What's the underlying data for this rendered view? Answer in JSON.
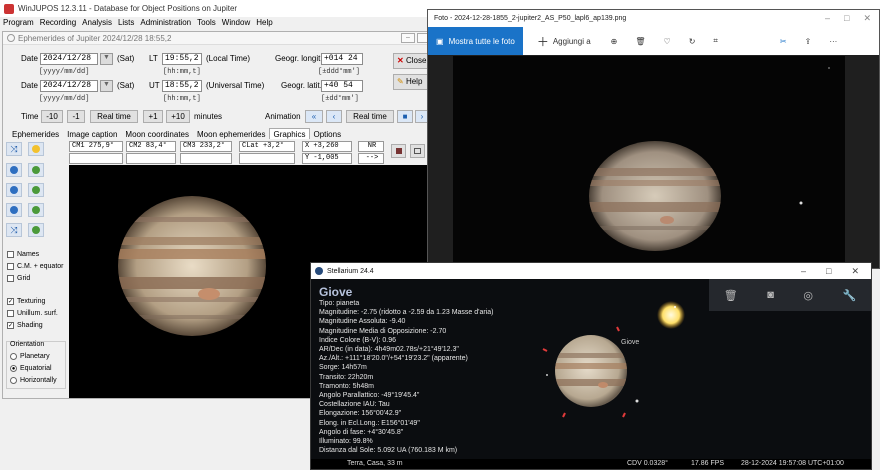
{
  "app": {
    "title": "WinJUPOS 12.3.11 - Database for Object Positions on Jupiter",
    "menu": [
      "Program",
      "Recording",
      "Analysis",
      "Lists",
      "Administration",
      "Tools",
      "Window",
      "Help"
    ]
  },
  "ephemerides": {
    "title": "Ephemerides of Jupiter  2024/12/28  18:55,2",
    "date_label": "Date",
    "date1": "2024/12/28",
    "sat1": "(Sat)",
    "lt_label": "LT",
    "lt_value": "19:55,2",
    "lt_desc": "(Local Time)",
    "date_fmt1": "[yyyy/mm/dd]",
    "time_fmt1": "[hh:mm,t]",
    "date2": "2024/12/28",
    "sat2": "(Sat)",
    "ut_label": "UT",
    "ut_value": "18:55,2",
    "ut_desc": "(Universal Time)",
    "date_fmt2": "[yyyy/mm/dd]",
    "time_fmt2": "[hh:mm,t]",
    "long_label": "Geogr. longit.",
    "long_value": "+014 24",
    "long_fmt": "[±ddd°mm']",
    "lat_label": "Geogr. latit.",
    "lat_value": "+40 54",
    "lat_fmt": "[±dd°mm']",
    "close_label": "Close",
    "help_label": "Help",
    "time_label": "Time",
    "btn_m10": "-10",
    "btn_m1": "-1",
    "realtime1": "Real time",
    "btn_p1": "+1",
    "btn_p10": "+10",
    "minutes": "minutes",
    "animation_label": "Animation",
    "realtime2": "Real time",
    "tabs": [
      "Ephemerides",
      "Image caption",
      "Moon coordinates",
      "Moon ephemerides",
      "Graphics",
      "Options"
    ],
    "cm1": "CM1  275,9°",
    "cm2": "CM2   83,4°",
    "cm3": "CM3  233,2°",
    "clat": "CLat  +3,2°",
    "x": "X   +3,260",
    "y": "Y   -1,005",
    "nr": "NR",
    "arrow": "-->",
    "checks": {
      "names": "Names",
      "cm_equator": "C.M. + equator",
      "grid": "Grid",
      "texturing": "Texturing",
      "unillum": "Unillum. surf.",
      "shading": "Shading"
    },
    "orientation": {
      "title": "Orientation",
      "planetary": "Planetary",
      "equatorial": "Equatorial",
      "horizontal": "Horizontally"
    }
  },
  "photos": {
    "title": "Foto - 2024-12-28-1855_2-jupiter2_AS_P50_lapl6_ap139.png",
    "show_all": "Mostra tutte le foto",
    "add": "Aggiungi a"
  },
  "stellarium": {
    "title": "Stellarium 24.4",
    "object_name": "Giove",
    "label_on_sky": "Giove",
    "lines": [
      "Tipo: pianeta",
      "Magnitudine: -2.75 (ridotto a -2.59 da 1.23 Masse d'aria)",
      "Magnitudine Assoluta: -9.40",
      "Magnitudine Media di Opposizione: -2.70",
      "Indice Colore (B-V): 0.96",
      "AR/Dec (in data): 4h49m02.78s/+21°49'12.3\"",
      "Az./Alt.: +111°18'20.0\"/+54°19'23.2\" (apparente)",
      "Sorge: 14h57m",
      "Transito: 22h20m",
      "Tramonto: 5h48m",
      "Angolo Parallattico: -49°19'45.4\"",
      "Costellazione IAU: Tau",
      "Elongazione: 156°00'42.9\"",
      "Elong. in Ecl.Long.: E156°01'49\"",
      "Angolo di fase: +4°30'45.8\"",
      "Illuminato: 99.8%",
      "Distanza dal Sole: 5.092 UA (760.183 M km)"
    ],
    "status_location": "Terra, Casa, 33 m",
    "status_fov": "CDV 0.0328°",
    "status_fps": "17.86 FPS",
    "status_time": "28-12-2024 19:57:08 UTC+01:00"
  }
}
